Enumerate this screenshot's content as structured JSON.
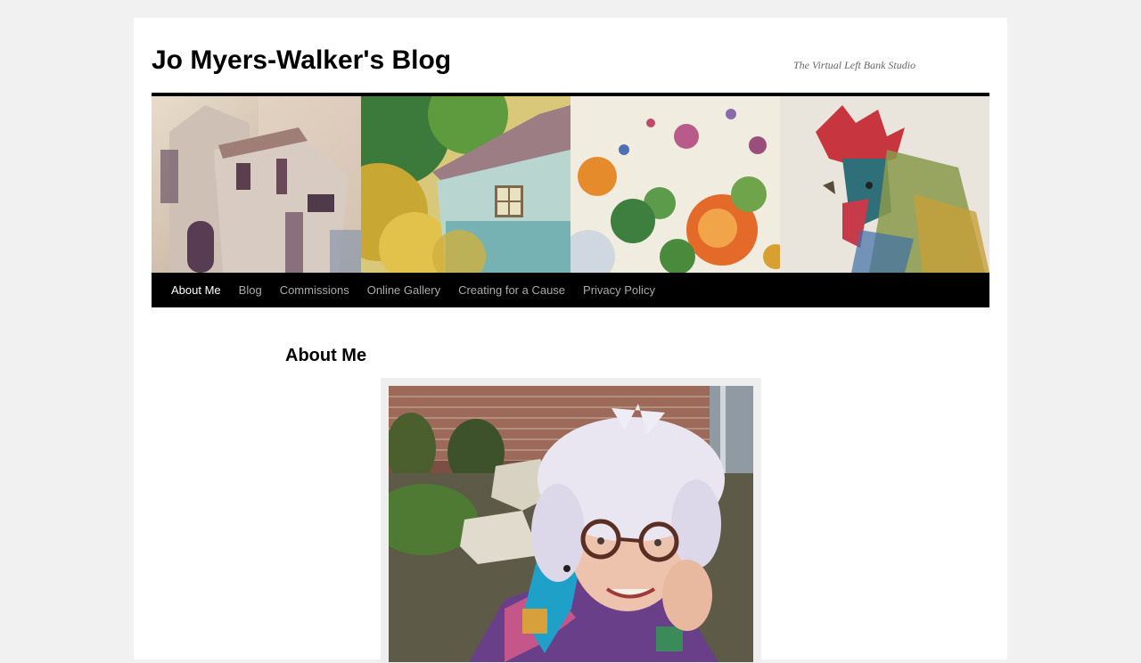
{
  "site": {
    "title": "Jo Myers-Walker's Blog",
    "description": "The Virtual Left Bank Studio"
  },
  "banner": {
    "panels": [
      "watercolor-church-tower",
      "watercolor-cottage",
      "watercolor-flowers",
      "watercolor-rooster"
    ]
  },
  "nav": {
    "items": [
      {
        "label": "About Me",
        "current": true
      },
      {
        "label": "Blog",
        "current": false
      },
      {
        "label": "Commissions",
        "current": false
      },
      {
        "label": "Online Gallery",
        "current": false
      },
      {
        "label": "Creating for a Cause",
        "current": false
      },
      {
        "label": "Privacy Policy",
        "current": false
      }
    ]
  },
  "page": {
    "title": "About Me",
    "photo": "portrait-of-jo-myers-walker"
  },
  "colors": {
    "background": "#f1f1f1",
    "nav_bg": "#000000",
    "nav_text": "#aaaaaa",
    "nav_current": "#ffffff"
  }
}
